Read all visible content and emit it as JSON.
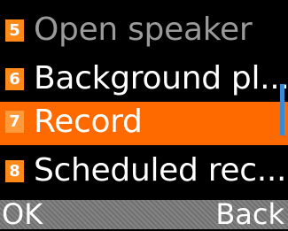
{
  "menu": {
    "items": [
      {
        "number": "5",
        "label": "Open speaker",
        "state": "disabled"
      },
      {
        "number": "6",
        "label": "Background pl...",
        "state": "normal"
      },
      {
        "number": "7",
        "label": "Record",
        "state": "selected"
      },
      {
        "number": "8",
        "label": "Scheduled rec...",
        "state": "normal"
      }
    ]
  },
  "softkeys": {
    "left": "OK",
    "right": "Back"
  },
  "colors": {
    "background": "#000000",
    "highlight": "#ff6a00",
    "badge": "#ff8a1a",
    "scrollbar": "#3a8bd6",
    "softkey_bar": "#7a7a7a",
    "disabled_text": "#9a9a9a"
  }
}
